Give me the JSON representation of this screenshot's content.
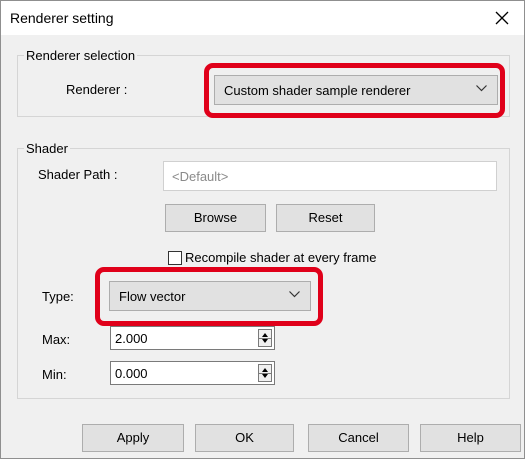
{
  "window": {
    "title": "Renderer setting"
  },
  "renderer_selection": {
    "legend": "Renderer selection",
    "label": "Renderer :",
    "selected": "Custom shader sample renderer"
  },
  "shader": {
    "legend": "Shader",
    "path_label": "Shader Path :",
    "path_placeholder": "<Default>",
    "browse_label": "Browse",
    "reset_label": "Reset",
    "recompile_label": "Recompile shader at every frame",
    "recompile_checked": false,
    "type_label": "Type:",
    "type_selected": "Flow vector",
    "max_label": "Max:",
    "max_value": "2.000",
    "min_label": "Min:",
    "min_value": "0.000"
  },
  "footer": {
    "apply_label": "Apply",
    "ok_label": "OK",
    "cancel_label": "Cancel",
    "help_label": "Help"
  },
  "colors": {
    "highlight": "#e0001a",
    "dialog_bg": "#f0f0f0",
    "button_bg": "#e1e1e1"
  },
  "icons": {
    "close": "close-icon",
    "dropdown": "chevron-down-icon"
  }
}
